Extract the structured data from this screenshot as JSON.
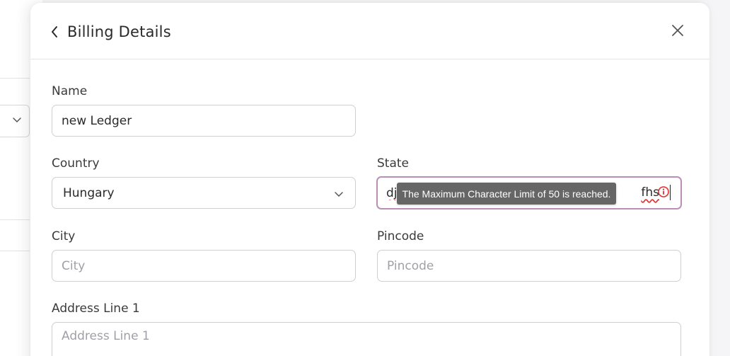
{
  "header": {
    "title": "Billing Details",
    "back_icon": "chevron-left-icon",
    "close_icon": "close-icon"
  },
  "form": {
    "name": {
      "label": "Name",
      "value": "new Ledger"
    },
    "country": {
      "label": "Country",
      "value": "Hungary"
    },
    "state": {
      "label": "State",
      "value": "djhkjhks",
      "value_end": "fhs",
      "error_tooltip": "The Maximum Character Limit of 50 is reached."
    },
    "city": {
      "label": "City",
      "placeholder": "City"
    },
    "pincode": {
      "label": "Pincode",
      "placeholder": "Pincode"
    },
    "address1": {
      "label": "Address Line 1",
      "placeholder": "Address Line 1"
    }
  },
  "colors": {
    "focus_border": "#b98fb6",
    "error": "#e03030",
    "tooltip_bg": "#666666"
  }
}
